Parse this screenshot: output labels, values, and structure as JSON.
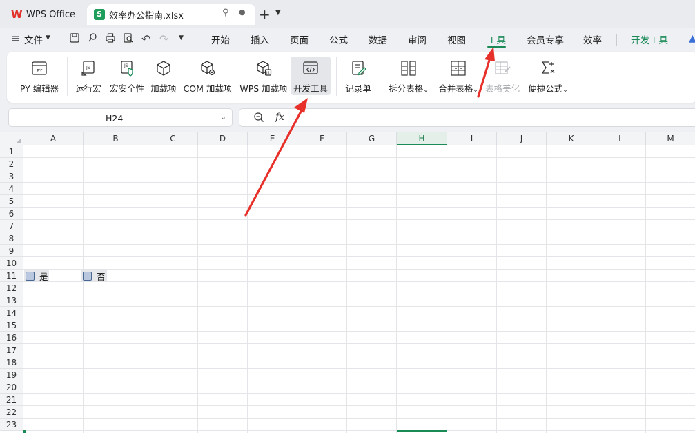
{
  "tabs": {
    "wps": {
      "label": "WPS Office"
    },
    "file": {
      "label": "效率办公指南.xlsx"
    }
  },
  "menu": {
    "file_label": "文件",
    "items": [
      {
        "id": "menu-kaishi",
        "label": "开始"
      },
      {
        "id": "menu-charu",
        "label": "插入"
      },
      {
        "id": "menu-yemian",
        "label": "页面"
      },
      {
        "id": "menu-gongshi",
        "label": "公式"
      },
      {
        "id": "menu-shuju",
        "label": "数据"
      },
      {
        "id": "menu-shenyue",
        "label": "审阅"
      },
      {
        "id": "menu-shitu",
        "label": "视图"
      },
      {
        "id": "menu-gongju",
        "label": "工具"
      },
      {
        "id": "menu-huiyuan",
        "label": "会员专享"
      },
      {
        "id": "menu-xiaolv",
        "label": "效率"
      }
    ],
    "devtools_label": "开发工具",
    "active": "工具"
  },
  "ribbon": {
    "buttons": [
      {
        "label": "PY 编辑器",
        "icon": "py-editor-icon"
      },
      {
        "label": "运行宏",
        "icon": "run-macro-icon"
      },
      {
        "label": "宏安全性",
        "icon": "macro-security-icon"
      },
      {
        "label": "加载项",
        "icon": "addin-icon"
      },
      {
        "label": "COM 加载项",
        "icon": "com-addin-icon"
      },
      {
        "label": "WPS 加载项",
        "icon": "wps-addin-icon"
      },
      {
        "label": "开发工具",
        "icon": "dev-tools-icon"
      },
      {
        "label": "记录单",
        "icon": "record-form-icon"
      },
      {
        "label": "拆分表格",
        "icon": "split-table-icon"
      },
      {
        "label": "合并表格",
        "icon": "merge-table-icon"
      },
      {
        "label": "表格美化",
        "icon": "beautify-table-icon"
      },
      {
        "label": "便捷公式",
        "icon": "quick-formula-icon"
      }
    ]
  },
  "formula": {
    "namebox": "H24",
    "fx": "fx"
  },
  "sheet": {
    "columns": [
      "A",
      "B",
      "C",
      "D",
      "E",
      "F",
      "G",
      "H",
      "I",
      "J",
      "K",
      "L",
      "M"
    ],
    "selected_column": "H",
    "rows": [
      "1",
      "2",
      "3",
      "4",
      "5",
      "6",
      "7",
      "8",
      "9",
      "10",
      "11",
      "12",
      "13",
      "14",
      "15",
      "16",
      "17",
      "18",
      "19",
      "20",
      "21",
      "22",
      "23"
    ],
    "checkboxes": [
      {
        "label": "是",
        "cell": "A11"
      },
      {
        "label": "否",
        "cell": "B11"
      }
    ]
  },
  "colors": {
    "accent": "#1a8a57",
    "arrow": "#e8302a"
  }
}
